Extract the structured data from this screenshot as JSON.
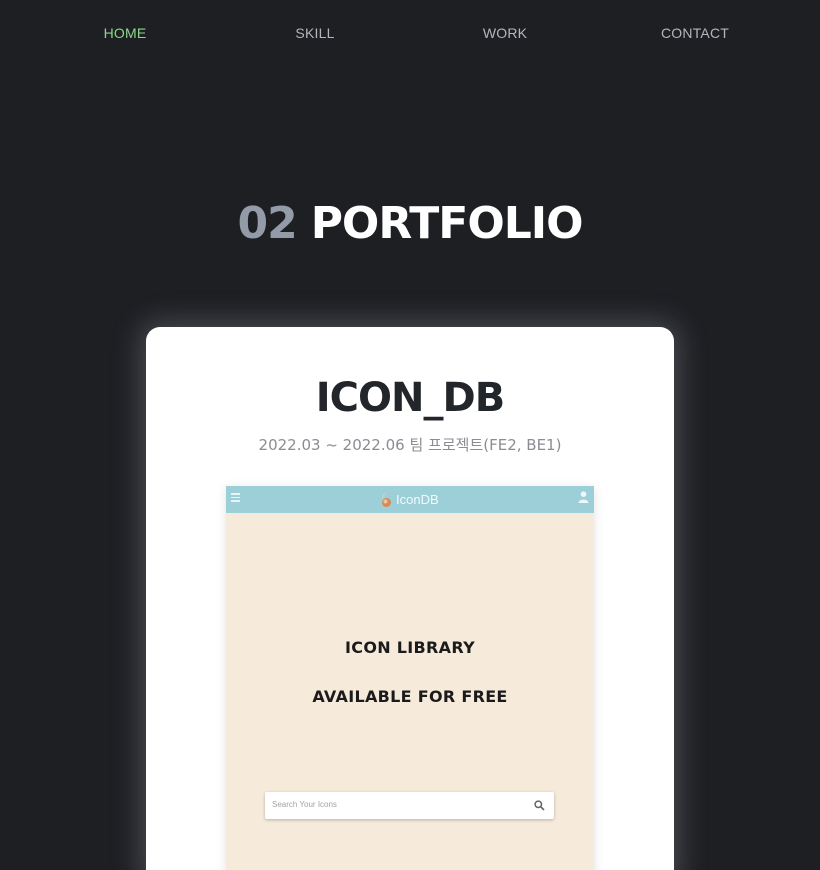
{
  "nav": {
    "items": [
      {
        "label": "HOME",
        "active": true
      },
      {
        "label": "SKILL",
        "active": false
      },
      {
        "label": "WORK",
        "active": false
      },
      {
        "label": "CONTACT",
        "active": false
      }
    ]
  },
  "section": {
    "number": "02",
    "title": "PORTFOLIO"
  },
  "project": {
    "title": "ICON_DB",
    "subtitle": "2022.03 ~ 2022.06 팀 프로젝트(FE2, BE1)",
    "preview": {
      "app_name": "IconDB",
      "headline_1": "ICON LIBRARY",
      "headline_2": "AVAILABLE FOR FREE",
      "search_placeholder": "Search Your Icons",
      "icons": [
        "hamburger-menu-icon",
        "icondb-logo-icon",
        "user-icon",
        "search-icon"
      ]
    }
  },
  "colors": {
    "background": "#1d1f23",
    "nav_active": "#8ad98a",
    "nav_inactive": "#b3b6bd",
    "section_number": "#939aa8",
    "preview_header": "#9dcfd9",
    "preview_body": "#f6eadb"
  }
}
